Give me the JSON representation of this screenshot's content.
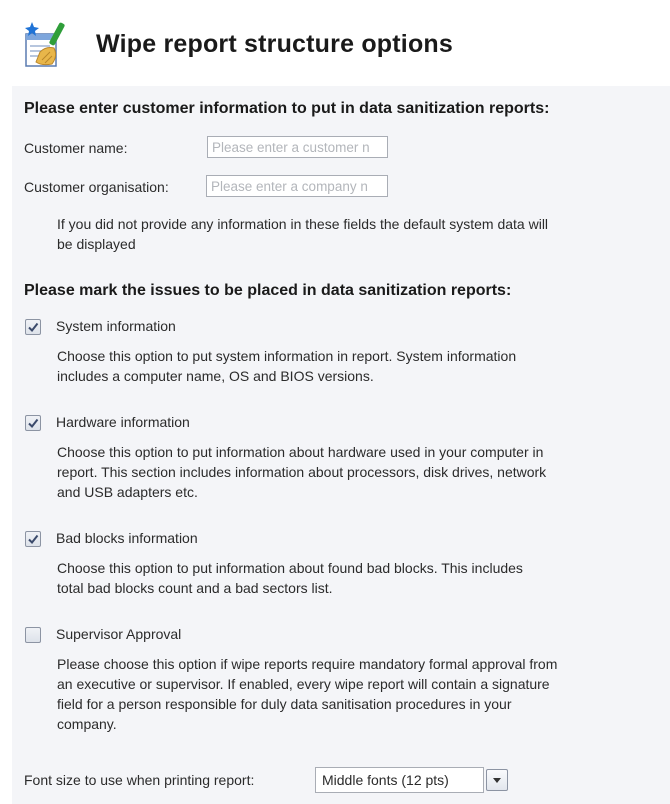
{
  "header": {
    "title": "Wipe report structure options",
    "icon": "wipe-report-icon"
  },
  "customer": {
    "heading": "Please enter customer information to put in data sanitization reports:",
    "name_label": "Customer name:",
    "name_placeholder": "Please enter a customer n",
    "org_label": "Customer organisation:",
    "org_placeholder": "Please enter a company n",
    "note_line1": "If you did not provide any information in these fields the default system data will",
    "note_line2": "be displayed"
  },
  "issues": {
    "heading": "Please mark the issues to be placed in data sanitization reports:",
    "items": [
      {
        "label": "System information",
        "checked": true,
        "description_lines": [
          "Choose this option to put system information in report. System information",
          "includes a computer name, OS and BIOS versions."
        ]
      },
      {
        "label": "Hardware information",
        "checked": true,
        "description_lines": [
          "Choose this option to put information about hardware used in your computer in",
          "report. This section includes information about processors, disk drives, network",
          "and USB adapters etc."
        ]
      },
      {
        "label": "Bad blocks information",
        "checked": true,
        "description_lines": [
          "Choose this option to put information about found bad blocks. This includes",
          "total bad blocks count and a bad sectors list."
        ]
      },
      {
        "label": "Supervisor Approval",
        "checked": false,
        "description_lines": [
          "Please choose this option if wipe reports require mandatory formal approval from",
          "an executive or supervisor. If enabled, every wipe report will contain a signature",
          "field for a person responsible for duly data sanitisation procedures in your",
          "company."
        ]
      }
    ]
  },
  "font_size": {
    "label": "Font size to use when printing report:",
    "selected": "Middle fonts (12 pts)"
  },
  "colors": {
    "panel_background": "#f4f5f8",
    "check_mark": "#3b4a6b"
  }
}
